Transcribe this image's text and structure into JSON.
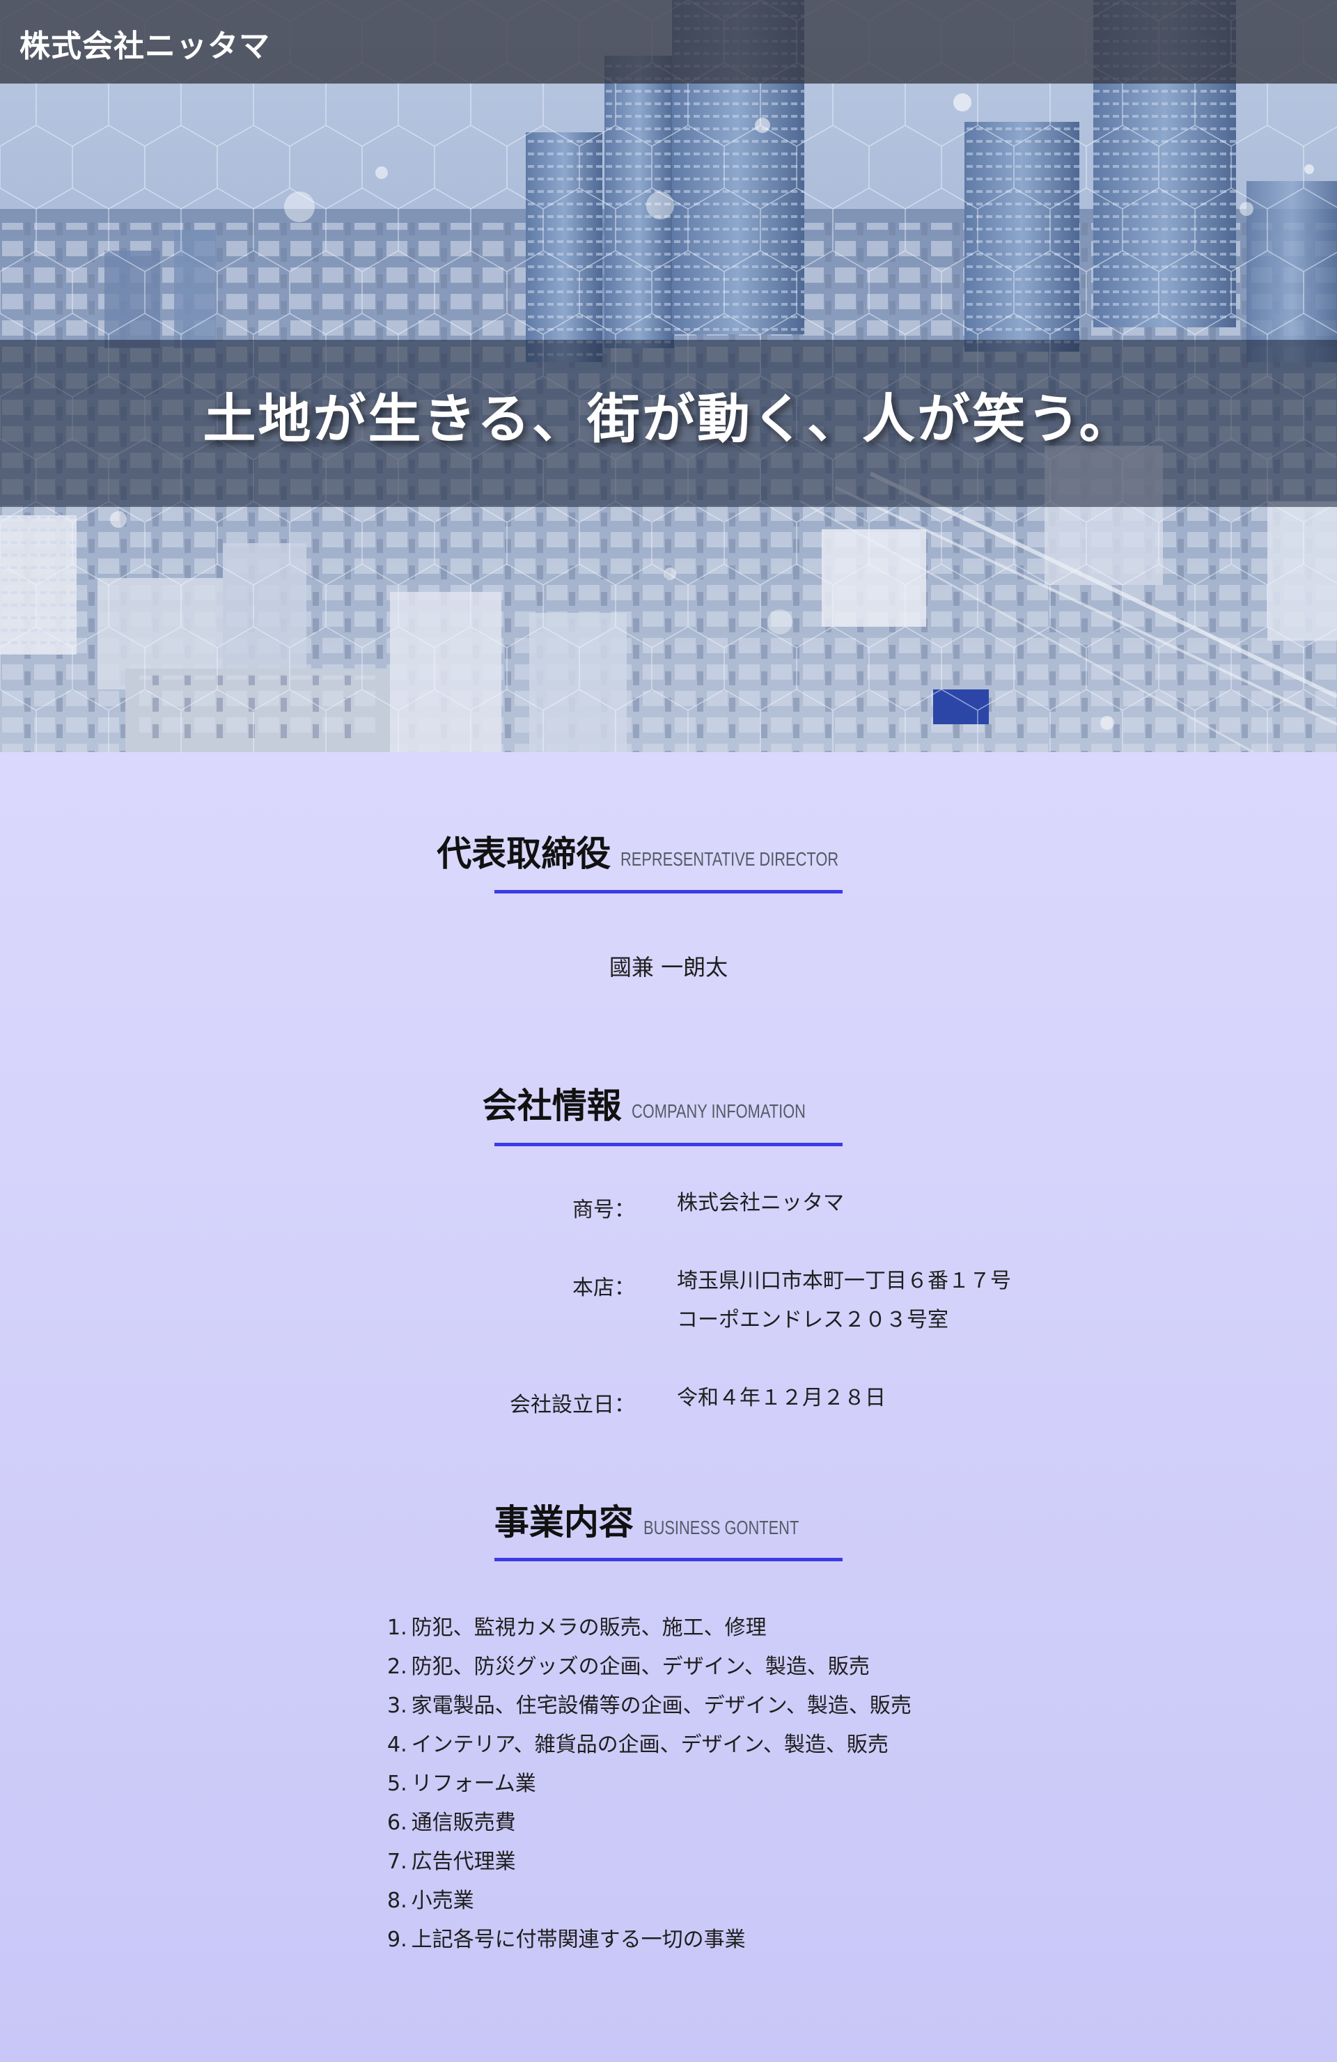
{
  "header": {
    "company_name": "株式会社ニッタマ"
  },
  "hero": {
    "tagline": "土地が生きる、街が動く、人が笑う。"
  },
  "representative": {
    "title": "代表取締役",
    "subtitle": "REPRESENTATIVE DIRECTOR",
    "name": "國兼 一朗太"
  },
  "company_info": {
    "title": "会社情報",
    "subtitle": "COMPANY INFOMATION",
    "trade_name_label": "商号：",
    "trade_name_value": "株式会社ニッタマ",
    "head_office_label": "本店：",
    "head_office_line1": "埼玉県川口市本町一丁目６番１７号",
    "head_office_line2": "コーポエンドレス２０３号室",
    "established_label": "会社設立日：",
    "established_value": "令和４年１２月２８日"
  },
  "business": {
    "title": "事業内容",
    "subtitle": "BUSINESS GONTENT",
    "items": [
      {
        "num": "1.",
        "text": "防犯、監視カメラの販売、施工、修理"
      },
      {
        "num": "2.",
        "text": "防犯、防災グッズの企画、デザイン、製造、販売"
      },
      {
        "num": "3.",
        "text": "家電製品、住宅設備等の企画、デザイン、製造、販売"
      },
      {
        "num": "4.",
        "text": "インテリア、雑貨品の企画、デザイン、製造、販売"
      },
      {
        "num": "5.",
        "text": "リフォーム業"
      },
      {
        "num": "6.",
        "text": "通信販売費"
      },
      {
        "num": "7.",
        "text": "広告代理業"
      },
      {
        "num": "8.",
        "text": "小売業"
      },
      {
        "num": "9.",
        "text": "上記各号に付帯関連する一切の事業"
      }
    ]
  },
  "colors": {
    "accent_rule": "#3c3ce6",
    "page_background_top": "#e2e0fd",
    "page_background_bottom": "#c8c7f7",
    "header_bar": "#373a44"
  }
}
